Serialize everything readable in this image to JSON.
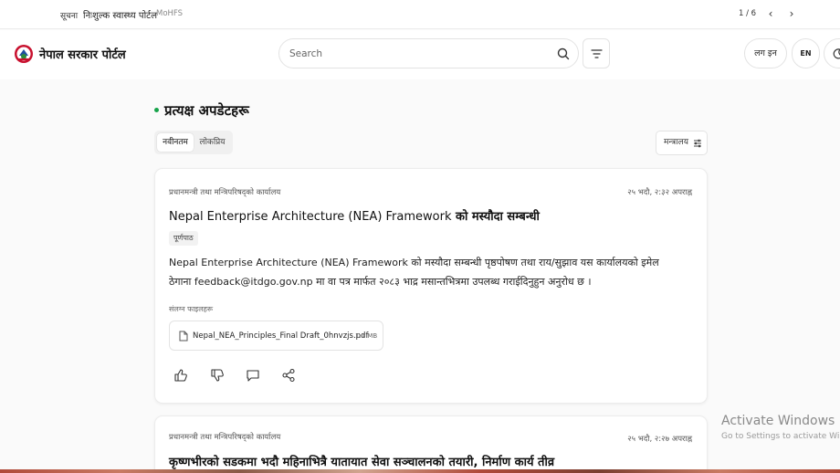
{
  "ticker": {
    "label": "सूचना",
    "message": "निःशुल्क स्वास्थ्य पोर्टल",
    "source": "MoHFS",
    "pager": "1 / 6",
    "prev_icon": "‹",
    "next_icon": "›"
  },
  "header": {
    "brand": "नेपाल सरकार पोर्टल",
    "search_placeholder": "Search",
    "login_label": "लग इन",
    "lang_label": "EN"
  },
  "section": {
    "title": "प्रत्यक्ष अपडेटहरू"
  },
  "tabs": [
    {
      "label": "नवीनतम",
      "active": true
    },
    {
      "label": "लोकप्रिय",
      "active": false
    }
  ],
  "ministry_filter": {
    "label": "मन्त्रालय"
  },
  "posts": [
    {
      "source": "प्रधानमन्त्री तथा मन्त्रिपरिषद्‌को कार्यालय",
      "date": "२५ भदौ, २:३२ अपराह्न",
      "title_en": "Nepal Enterprise Architecture (NEA) Framework",
      "title_ne": " को मस्यौदा सम्बन्धी",
      "badge": "पूर्णपाठ",
      "body": "Nepal Enterprise Architecture (NEA) Framework को मस्यौदा सम्बन्धी पृष्ठपोषण तथा राय/सुझाव यस कार्यालयको इमेल ठेगाना feedback@itdgo.gov.np मा वा पत्र मार्फत २०८३ भाद्र मसान्तभित्रमा उपलब्ध गराईदिनुहुन अनुरोध छ ।",
      "attachments_label": "संलग्न फाइलहरू",
      "attachment": {
        "name": "Nepal_NEA_Principles_Final Draft_0hnvzjs.pdf",
        "size": "1.1 MB"
      }
    },
    {
      "source": "प्रधानमन्त्री तथा मन्त्रिपरिषद्‌को कार्यालय",
      "date": "२५ भदौ, २:२७ अपराह्न",
      "title": "कृष्णभीरको सडकमा भदौ महिनाभित्रै यातायात सेवा सञ्चालनको तयारी, निर्माण कार्य तीव्र"
    }
  ],
  "watermark": {
    "line1": "Activate Windows",
    "line2": "Go to Settings to activate Windows."
  },
  "colors": {
    "live_dot": "#16a34a",
    "page_bg": "#fafafa"
  }
}
